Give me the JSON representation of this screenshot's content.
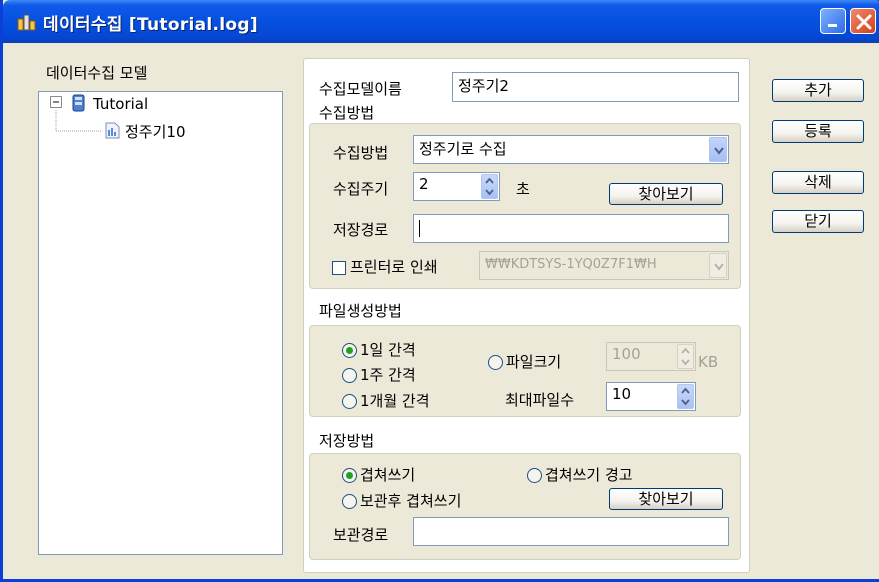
{
  "window": {
    "title": "데이터수집 [Tutorial.log]"
  },
  "tree": {
    "label": "데이터수집 모델",
    "root": {
      "expander": "⊟",
      "label": "Tutorial"
    },
    "child": {
      "label": "정주기10"
    }
  },
  "model": {
    "name_label": "수집모델이름",
    "name_value": "정주기2"
  },
  "collect": {
    "group_label": "수집방법",
    "method_label": "수집방법",
    "method_value": "정주기로 수집",
    "period_label": "수집주기",
    "period_value": "2",
    "period_unit": "초",
    "browse_label": "찾아보기",
    "save_path_label": "저장경로",
    "save_path_value": "",
    "printer_label": "프린터로 인쇄",
    "printer_checked": false,
    "printer_value": "₩₩KDTSYS-1YQ0Z7F1₩H"
  },
  "file_gen": {
    "group_label": "파일생성방법",
    "option_day": "1일 간격",
    "option_week": "1주 간격",
    "option_month": "1개월 간격",
    "option_size": "파일크기",
    "size_value": "100",
    "size_unit": "KB",
    "max_files_label": "최대파일수",
    "max_files_value": "10",
    "selected": "1일 간격"
  },
  "save_method": {
    "group_label": "저장방법",
    "option_overwrite": "겹쳐쓰기",
    "option_overwrite_warn": "겹쳐쓰기 경고",
    "option_backup_overwrite": "보관후 겹쳐쓰기",
    "browse_label": "찾아보기",
    "backup_path_label": "보관경로",
    "backup_path_value": "",
    "selected": "겹쳐쓰기"
  },
  "actions": {
    "add": "추가",
    "register": "등록",
    "delete": "삭제",
    "close": "닫기"
  },
  "colors": {
    "titlebar": "#0550e0",
    "face": "#ece9d8",
    "radio_dot": "#21a121"
  }
}
